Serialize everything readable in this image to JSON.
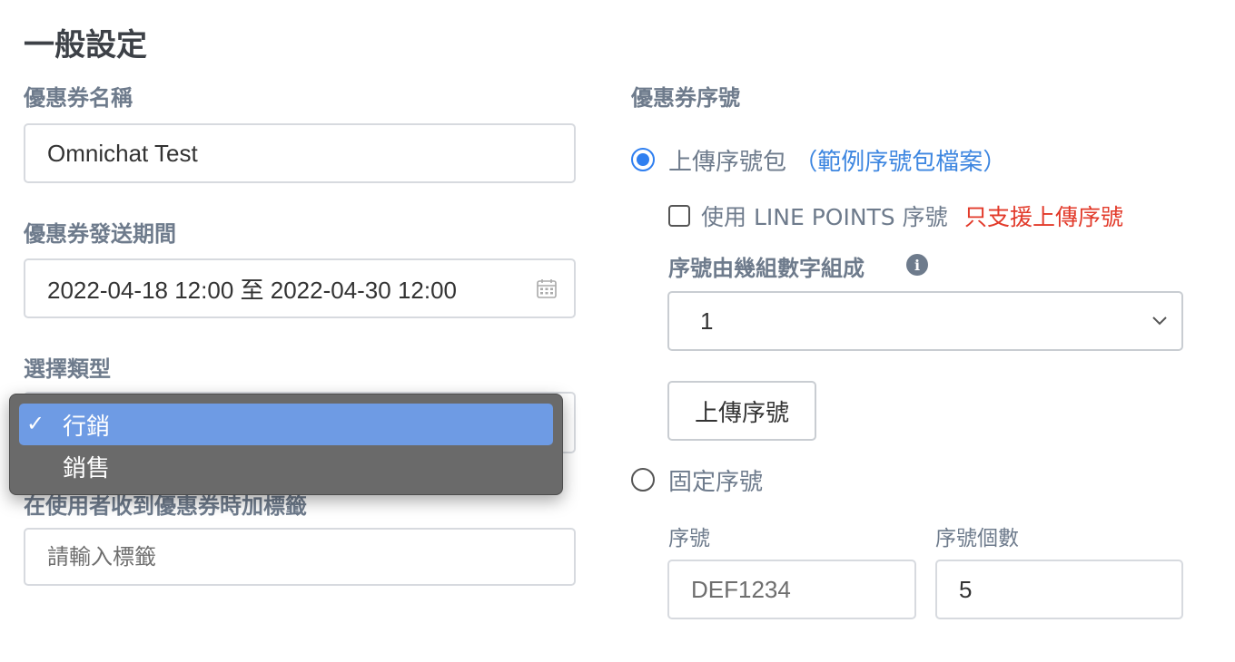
{
  "page_title": "一般設定",
  "left": {
    "coupon_name": {
      "label": "優惠券名稱",
      "value": "Omnichat Test"
    },
    "send_period": {
      "label": "優惠券發送期間",
      "value": "2022-04-18 12:00 至 2022-04-30 12:00",
      "icon": "calendar-icon"
    },
    "type": {
      "label": "選擇類型",
      "options": [
        "行銷",
        "銷售"
      ],
      "selected": "行銷",
      "check_glyph": "✓"
    },
    "tag": {
      "label": "在使用者收到優惠券時加標籤",
      "placeholder": "請輸入標籤"
    }
  },
  "right": {
    "serial_label": "優惠券序號",
    "upload_option": {
      "label": "上傳序號包",
      "paren_open": "（",
      "link": "範例序號包檔案",
      "paren_close": "）",
      "checked": true
    },
    "line_points": {
      "label": "使用 LINE POINTS 序號",
      "warning": "只支援上傳序號",
      "checked": false
    },
    "groups": {
      "label": "序號由幾組數字組成",
      "value": "1",
      "icon": "info-icon"
    },
    "upload_button": "上傳序號",
    "fixed_option": {
      "label": "固定序號",
      "checked": false
    },
    "serial_field": {
      "label": "序號",
      "placeholder": "DEF1234"
    },
    "count_field": {
      "label": "序號個數",
      "value": "5"
    }
  },
  "colors": {
    "accent": "#2f7ff0",
    "link": "#3d86e0",
    "warning": "#e23a2a",
    "label": "#6e7b8c",
    "dropdown_highlight": "#6e9be4"
  }
}
